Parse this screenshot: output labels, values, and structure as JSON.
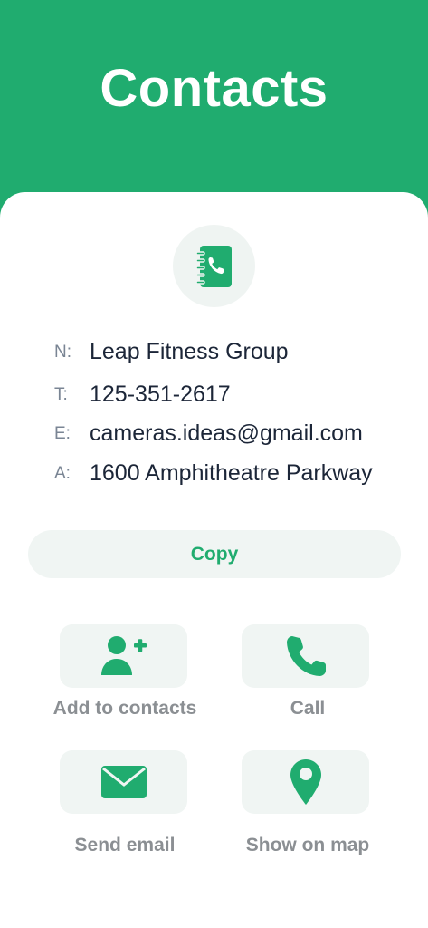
{
  "header": {
    "title": "Contacts"
  },
  "contact": {
    "fields": [
      {
        "label": "N:",
        "value": "Leap Fitness Group"
      },
      {
        "label": "T:",
        "value": "125-351-2617"
      },
      {
        "label": "E:",
        "value": "cameras.ideas@gmail.com"
      },
      {
        "label": "A:",
        "value": "1600 Amphitheatre Parkway"
      }
    ]
  },
  "copy_button": {
    "label": "Copy"
  },
  "actions": [
    {
      "label": "Add to contacts",
      "icon": "add-person-icon"
    },
    {
      "label": "Call",
      "icon": "phone-icon"
    },
    {
      "label": "Send email",
      "icon": "envelope-icon"
    },
    {
      "label": "Show on map",
      "icon": "map-pin-icon"
    }
  ],
  "colors": {
    "accent": "#20ac6f",
    "tile_bg": "#f0f5f3",
    "text_dark": "#1c2638",
    "label_gray": "#8b8f93"
  }
}
